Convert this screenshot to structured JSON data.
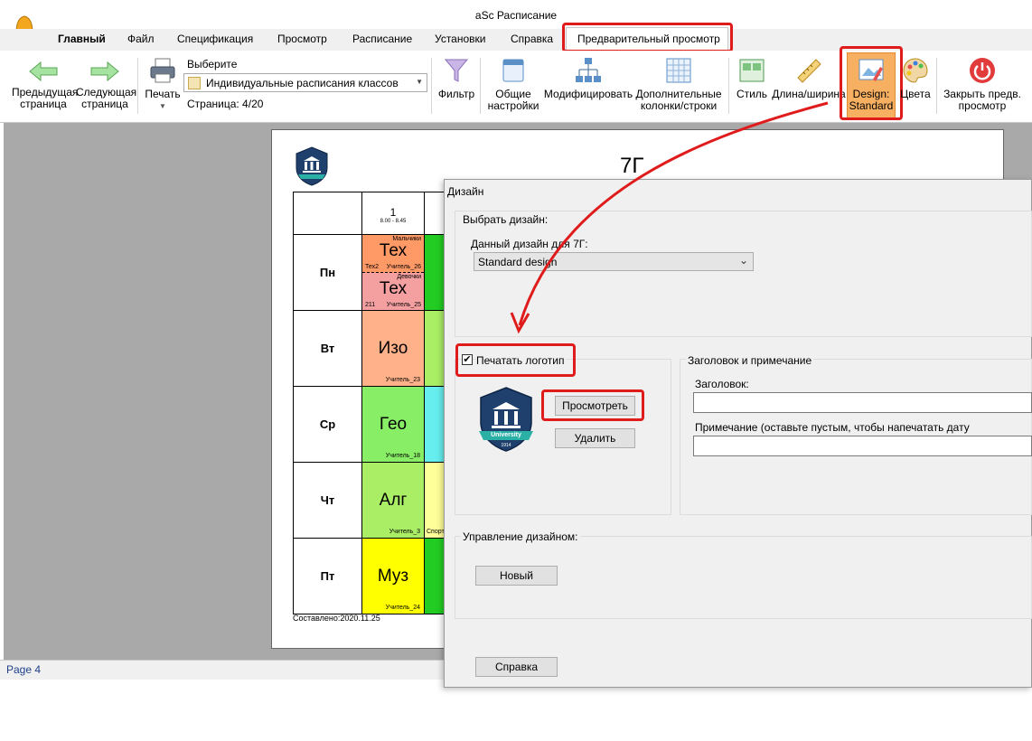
{
  "window": {
    "title": "aSc Расписание"
  },
  "menu": {
    "tabs": [
      "Главный",
      "Файл",
      "Спецификация",
      "Просмотр",
      "Расписание",
      "Установки",
      "Справка",
      "Предварительный просмотр"
    ]
  },
  "ribbon": {
    "prev_page": "Предыдущая страница",
    "next_page": "Следующая страница",
    "print": "Печать",
    "choose_label": "Выберите",
    "choose_value": "Индивидуальные расписания классов",
    "page_info": "Страница: 4/20",
    "filter": "Фильтр",
    "general_settings": "Общие настройки",
    "modify": "Модифицировать",
    "extra_cols": "Дополнительные колонки/строки",
    "style": "Стиль",
    "length_width": "Длина/ширина",
    "design_btn": "Design: Standard",
    "colors": "Цвета",
    "close_preview": "Закрыть предв. просмотр"
  },
  "timetable": {
    "class_title": "7Г",
    "period_num": "1",
    "period_time": "8.00 - 8.45",
    "days": [
      "Пн",
      "Вт",
      "Ср",
      "Чт",
      "Пт"
    ],
    "mon_a": {
      "group": "Мальчики",
      "subject": "Тех",
      "room": "Тех2",
      "teacher": "Учитель_26"
    },
    "mon_b": {
      "group": "Девочки",
      "subject": "Тех",
      "room": "211",
      "teacher": "Учитель_25"
    },
    "tue": {
      "subject": "Изо",
      "teacher": "Учитель_23"
    },
    "wed": {
      "subject": "Гео",
      "teacher": "Учитель_18"
    },
    "thu": {
      "subject": "Алг",
      "teacher": "Учитель_3",
      "next_room": "Спорт"
    },
    "fri": {
      "subject": "Муз",
      "teacher": "Учитель_24"
    },
    "footer": "Составлено:2020.11.25"
  },
  "status": {
    "page": "Page 4"
  },
  "dialog": {
    "title": "Дизайн",
    "choose_design_group": "Выбрать дизайн:",
    "design_for_label": "Данный дизайн для 7Г:",
    "design_value": "Standard design",
    "print_logo": "Печатать логотип",
    "view_button": "Просмотреть",
    "delete_button": "Удалить",
    "header_group": "Заголовок и примечание",
    "header_label": "Заголовок:",
    "note_label": "Примечание (оставьте пустым, чтобы напечатать дату составления):",
    "manage_group": "Управление дизайном:",
    "new_button": "Новый",
    "help_button": "Справка"
  },
  "logo": {
    "text": "University",
    "year": "1914"
  },
  "colors": {
    "tex": "#ff9966",
    "tex_b": "#f4a0a0",
    "izo": "#ffb28a",
    "geo": "#88ee66",
    "alg": "#aaee66",
    "muz": "#ffff00",
    "green": "#22cc22",
    "annotation": "#e01b1b"
  }
}
